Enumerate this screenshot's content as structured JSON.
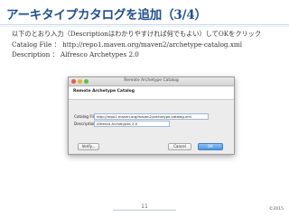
{
  "slide": {
    "title": "アーキタイプカタログを追加（3/4）",
    "instruction": "以下のとおり入力（Descriptionはわかりやすければ何でもよい）してOKをクリック",
    "info_catalog": "Catalog File ： http://repo1.maven.org/maven2/archetype-catalog.xml",
    "info_description": "Description ： Alfresco Archetypes 2.0",
    "page_number": "11",
    "copyright": "©2015"
  },
  "dialog": {
    "title": "Remote Archetype Catalog",
    "header": "Remote Archetype Catalog",
    "catalog_label": "Catalog File:",
    "catalog_value": "http://repo1.maven.org/maven2/archetype-catalog.xml",
    "description_label": "Description:",
    "description_value": "Alfresco Archetypes 2.0",
    "verify_label": "Verify...",
    "cancel_label": "Cancel",
    "ok_label": "OK"
  }
}
